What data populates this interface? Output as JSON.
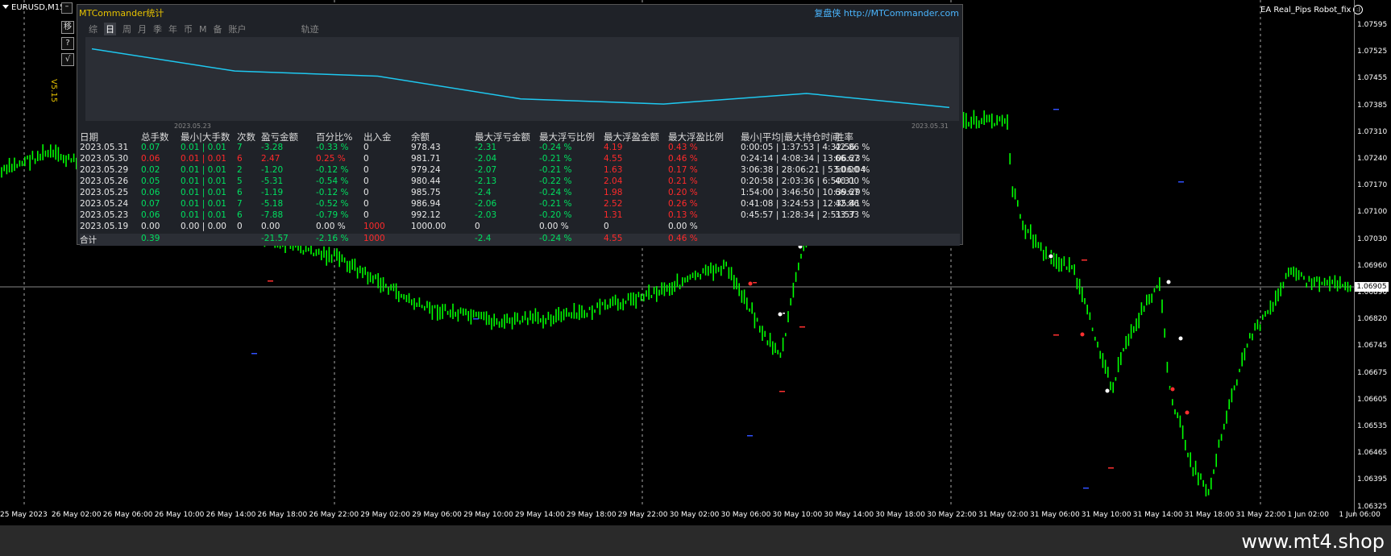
{
  "chart": {
    "symbol": "EURUSD,M15",
    "ea_name": "EA Real_Pips Robot_fix",
    "current_price": "1.06905",
    "price_labels": [
      "1.07595",
      "1.07525",
      "1.07455",
      "1.07385",
      "1.07310",
      "1.07240",
      "1.07170",
      "1.07100",
      "1.07030",
      "1.06960",
      "1.06890",
      "1.06820",
      "1.06745",
      "1.06675",
      "1.06605",
      "1.06535",
      "1.06465",
      "1.06395",
      "1.06325"
    ],
    "time_labels": [
      "25 May 2023",
      "26 May 02:00",
      "26 May 06:00",
      "26 May 10:00",
      "26 May 14:00",
      "26 May 18:00",
      "26 May 22:00",
      "29 May 02:00",
      "29 May 06:00",
      "29 May 10:00",
      "29 May 14:00",
      "29 May 18:00",
      "29 May 22:00",
      "30 May 02:00",
      "30 May 06:00",
      "30 May 10:00",
      "30 May 14:00",
      "30 May 18:00",
      "30 May 22:00",
      "31 May 02:00",
      "31 May 06:00",
      "31 May 10:00",
      "31 May 14:00",
      "31 May 18:00",
      "31 May 22:00",
      "1 Jun 02:00",
      "1 Jun 06:00"
    ],
    "candle_color": "#00ff00",
    "background": "#000000"
  },
  "side_buttons": [
    "移",
    "?",
    "√"
  ],
  "version": "V5.15",
  "panel": {
    "title": "MTCommander统计",
    "brand": "复盘侠",
    "url": "http://MTCommander.com",
    "tabs": [
      "综",
      "日",
      "周",
      "月",
      "季",
      "年",
      "币",
      "M",
      "备",
      "账户",
      "",
      "轨迹"
    ],
    "active_tab": "日",
    "graph_start": "2023.05.23",
    "graph_end": "2023.05.31",
    "curve_color": "#1ec8f0",
    "headers": [
      "日期",
      "总手数",
      "最小|大手数",
      "次数",
      "盈亏金额",
      "百分比%",
      "出入金",
      "余额",
      "最大浮亏金额",
      "最大浮亏比例",
      "最大浮盈金额",
      "最大浮盈比例",
      "最小|平均|最大持仓时间",
      "胜率"
    ],
    "rows": [
      {
        "date": "2023.05.31",
        "lots": "0.07",
        "minmax": "0.01 | 0.01",
        "count": "7",
        "pl": "-3.28",
        "pct": "-0.33 %",
        "io": "0",
        "bal": "978.43",
        "mfl": "-2.31",
        "mflp": "-0.24 %",
        "mfp": "4.19",
        "mfpp": "0.43 %",
        "hold": "0:00:05 | 1:37:53 | 4:32:56",
        "win": "42.86 %",
        "color": "g"
      },
      {
        "date": "2023.05.30",
        "lots": "0.06",
        "minmax": "0.01 | 0.01",
        "count": "6",
        "pl": "2.47",
        "pct": "0.25 %",
        "io": "0",
        "bal": "981.71",
        "mfl": "-2.04",
        "mflp": "-0.21 %",
        "mfp": "4.55",
        "mfpp": "0.46 %",
        "hold": "0:24:14 | 4:08:34 | 13:06:23",
        "win": "66.67 %",
        "color": "r"
      },
      {
        "date": "2023.05.29",
        "lots": "0.02",
        "minmax": "0.01 | 0.01",
        "count": "2",
        "pl": "-1.20",
        "pct": "-0.12 %",
        "io": "0",
        "bal": "979.24",
        "mfl": "-2.07",
        "mflp": "-0.21 %",
        "mfp": "1.63",
        "mfpp": "0.17 %",
        "hold": "3:06:38 | 28:06:21 | 53:06:04",
        "win": "50.00 %",
        "color": "g"
      },
      {
        "date": "2023.05.26",
        "lots": "0.05",
        "minmax": "0.01 | 0.01",
        "count": "5",
        "pl": "-5.31",
        "pct": "-0.54 %",
        "io": "0",
        "bal": "980.44",
        "mfl": "-2.13",
        "mflp": "-0.22 %",
        "mfp": "2.04",
        "mfpp": "0.21 %",
        "hold": "0:20:58 | 2:03:36 | 6:50:31",
        "win": "40.00 %",
        "color": "g"
      },
      {
        "date": "2023.05.25",
        "lots": "0.06",
        "minmax": "0.01 | 0.01",
        "count": "6",
        "pl": "-1.19",
        "pct": "-0.12 %",
        "io": "0",
        "bal": "985.75",
        "mfl": "-2.4",
        "mflp": "-0.24 %",
        "mfp": "1.98",
        "mfpp": "0.20 %",
        "hold": "1:54:00 | 3:46:50 | 10:39:29",
        "win": "66.67 %",
        "color": "g"
      },
      {
        "date": "2023.05.24",
        "lots": "0.07",
        "minmax": "0.01 | 0.01",
        "count": "7",
        "pl": "-5.18",
        "pct": "-0.52 %",
        "io": "0",
        "bal": "986.94",
        "mfl": "-2.06",
        "mflp": "-0.21 %",
        "mfp": "2.52",
        "mfpp": "0.26 %",
        "hold": "0:41:08 | 3:24:53 | 12:35:41",
        "win": "42.86 %",
        "color": "g"
      },
      {
        "date": "2023.05.23",
        "lots": "0.06",
        "minmax": "0.01 | 0.01",
        "count": "6",
        "pl": "-7.88",
        "pct": "-0.79 %",
        "io": "0",
        "bal": "992.12",
        "mfl": "-2.03",
        "mflp": "-0.20 %",
        "mfp": "1.31",
        "mfpp": "0.13 %",
        "hold": "0:45:57 | 1:28:34 | 2:51:57",
        "win": "33.33 %",
        "color": "g"
      },
      {
        "date": "2023.05.19",
        "lots": "0.00",
        "minmax": "0.00 | 0.00",
        "count": "0",
        "pl": "0.00",
        "pct": "0.00 %",
        "io": "1000",
        "bal": "1000.00",
        "mfl": "0",
        "mflp": "0.00 %",
        "mfp": "0",
        "mfpp": "0.00 %",
        "hold": "",
        "win": "",
        "color": "w"
      }
    ],
    "total": {
      "label": "合计",
      "lots": "0.39",
      "pl": "-21.57",
      "pct": "-2.16 %",
      "io": "1000",
      "mfl": "-2.4",
      "mflp": "-0.24 %",
      "mfp": "4.55",
      "mfpp": "0.46 %"
    },
    "curve_balances": [
      992.12,
      986.94,
      985.75,
      980.44,
      979.24,
      981.71,
      978.43
    ]
  },
  "watermark": "www.mt4.shop"
}
